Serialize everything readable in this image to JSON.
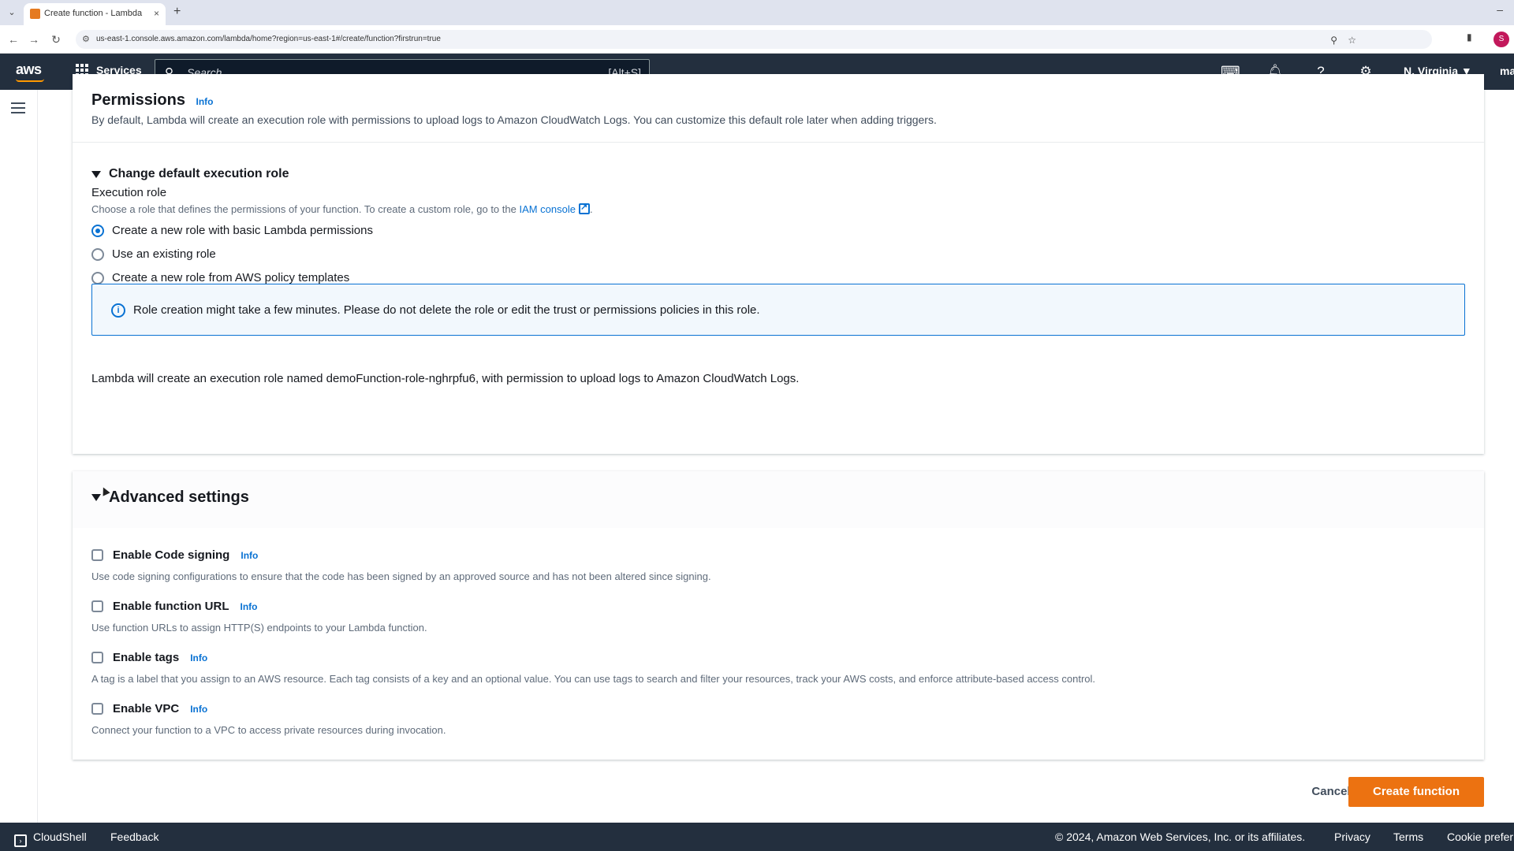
{
  "browser": {
    "tab_title": "Create function - Lambda",
    "tab_close": "×",
    "new_tab": "+",
    "minimize": "–",
    "url": "us-east-1.console.aws.amazon.com/lambda/home?region=us-east-1#/create/function?firstrun=true",
    "profile_initial": "S"
  },
  "aws_nav": {
    "logo": "aws",
    "services": "Services",
    "search_placeholder": "Search",
    "search_shortcut": "[Alt+S]",
    "region": "N. Virginia ▼",
    "account": "ma",
    "icons": [
      "cloudshell-icon",
      "notifications-icon",
      "help-icon",
      "settings-icon"
    ]
  },
  "permissions": {
    "title": "Permissions",
    "info": "Info",
    "description": "By default, Lambda will create an execution role with permissions to upload logs to Amazon CloudWatch Logs. You can customize this default role later when adding triggers.",
    "change_role_label": "Change default execution role",
    "execution_role_label": "Execution role",
    "execution_role_desc_prefix": "Choose a role that defines the permissions of your function. To create a custom role, go to the ",
    "iam_link": "IAM console",
    "execution_role_desc_suffix": ".",
    "options": [
      {
        "label": "Create a new role with basic Lambda permissions",
        "selected": true
      },
      {
        "label": "Use an existing role",
        "selected": false
      },
      {
        "label": "Create a new role from AWS policy templates",
        "selected": false
      }
    ],
    "alert_text": "Role creation might take a few minutes. Please do not delete the role or edit the trust or permissions policies in this role.",
    "role_summary": "Lambda will create an execution role named demoFunction-role-nghrpfu6, with permission to upload logs to Amazon CloudWatch Logs."
  },
  "advanced": {
    "title": "Advanced settings",
    "items": [
      {
        "label": "Enable Code signing",
        "info": "Info",
        "desc": "Use code signing configurations to ensure that the code has been signed by an approved source and has not been altered since signing."
      },
      {
        "label": "Enable function URL",
        "info": "Info",
        "desc": "Use function URLs to assign HTTP(S) endpoints to your Lambda function."
      },
      {
        "label": "Enable tags",
        "info": "Info",
        "desc": "A tag is a label that you assign to an AWS resource. Each tag consists of a key and an optional value. You can use tags to search and filter your resources, track your AWS costs, and enforce attribute-based access control."
      },
      {
        "label": "Enable VPC",
        "info": "Info",
        "desc": "Connect your function to a VPC to access private resources during invocation."
      }
    ]
  },
  "actions": {
    "cancel": "Cancel",
    "create": "Create function"
  },
  "footer": {
    "cloudshell": "CloudShell",
    "feedback": "Feedback",
    "copyright": "© 2024, Amazon Web Services, Inc. or its affiliates.",
    "privacy": "Privacy",
    "terms": "Terms",
    "cookie": "Cookie prefer"
  },
  "colors": {
    "nav_bg": "#232f3e",
    "accent": "#0972d3",
    "primary_button": "#ec7211"
  }
}
